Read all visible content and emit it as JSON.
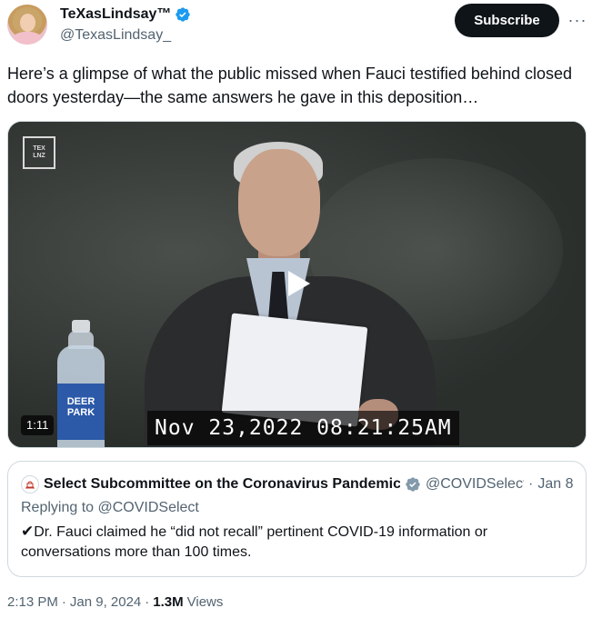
{
  "author": {
    "display_name": "TeXasLindsay™",
    "handle": "@TexasLindsay_",
    "verified_icon": "verified-badge-blue"
  },
  "actions": {
    "subscribe_label": "Subscribe",
    "more_label": "···"
  },
  "tweet": {
    "text": "Here’s a glimpse of what the public missed when Fauci testified behind closed doors yesterday—the same answers he gave in this deposition…"
  },
  "media": {
    "logo_line1": "TEX",
    "logo_line2": "LNZ",
    "bottle_label_line1": "DEER",
    "bottle_label_line2": "PARK",
    "timestamp_overlay": "Nov 23,2022 08:21:25AM",
    "duration": "1:11",
    "play_icon": "play-icon"
  },
  "quoted_tweet": {
    "display_name": "Select Subcommittee on the Coronavirus Pandemic",
    "handle": "@COVIDSelect",
    "separator": "·",
    "date": "Jan 8",
    "replying_to": "Replying to @COVIDSelect",
    "check_mark": "✔",
    "text": "Dr. Fauci claimed he “did not recall” pertinent COVID-19 information or conversations more than 100 times.",
    "badge_icon": "government-badge-gray"
  },
  "meta": {
    "time": "2:13 PM",
    "sep1": "·",
    "date": "Jan 9, 2024",
    "sep2": "·",
    "views_count": "1.3M",
    "views_label": "Views"
  },
  "colors": {
    "primary_text": "#0f1419",
    "secondary_text": "#536471",
    "verified_blue": "#1d9bf0",
    "border": "#cfd9de"
  }
}
